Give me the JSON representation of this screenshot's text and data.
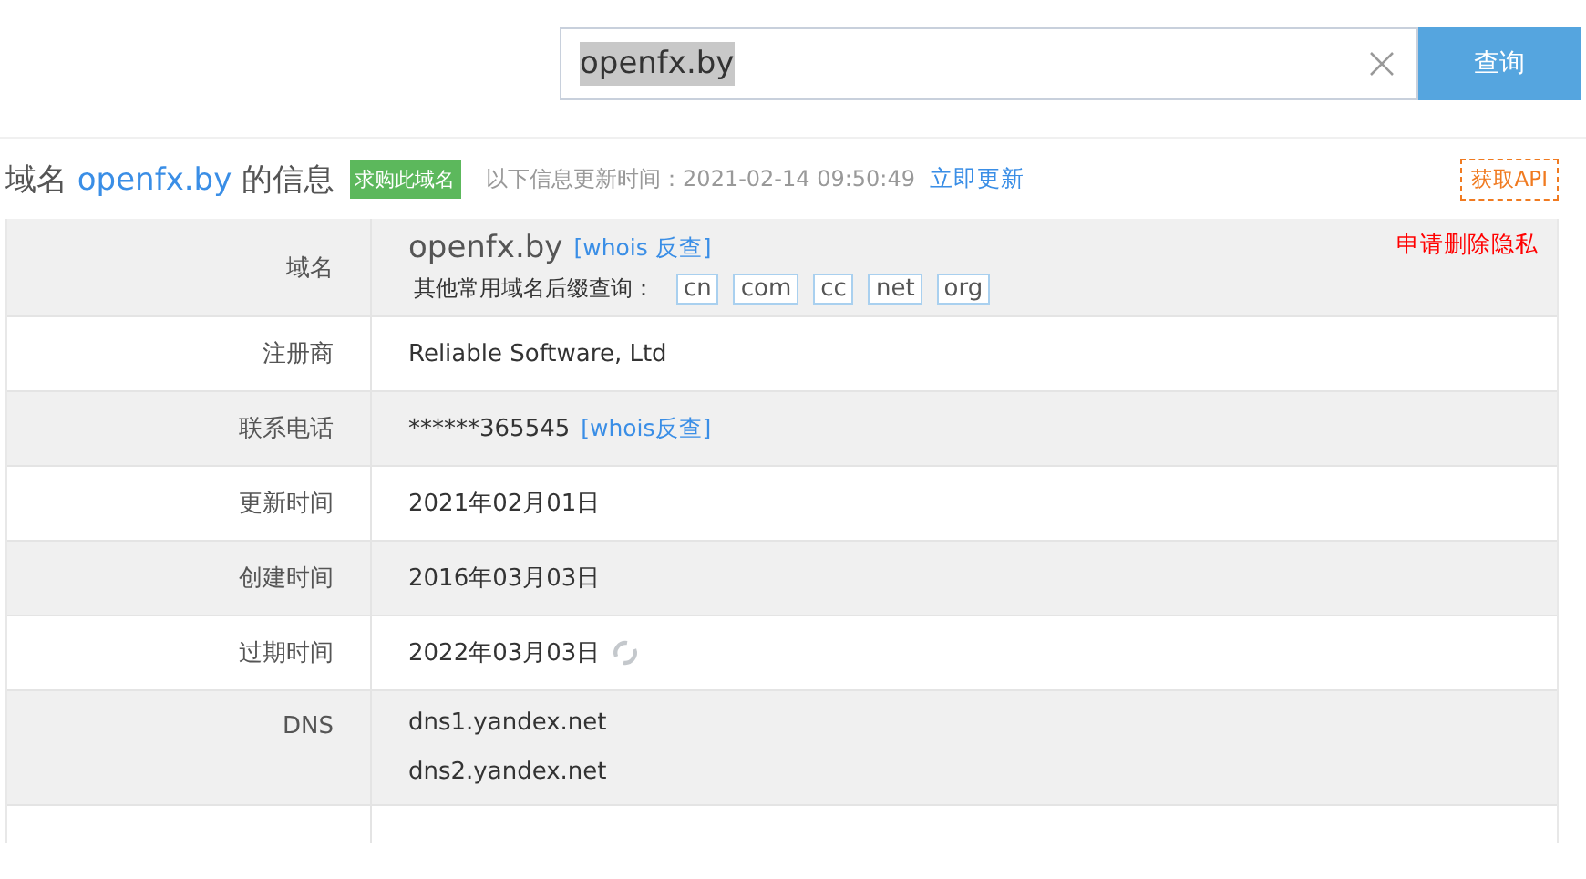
{
  "search": {
    "value": "openfx.by",
    "button": "查询"
  },
  "header": {
    "title_prefix": "域名",
    "domain": "openfx.by",
    "title_suffix": "的信息",
    "buy_badge": "求购此域名",
    "updated_label": "以下信息更新时间：2021-02-14 09:50:49",
    "update_link": "立即更新",
    "api_button": "获取API"
  },
  "rows": [
    {
      "kind": "domain",
      "label": "域名",
      "value": "openfx.by",
      "link": "[whois 反查]",
      "privacy_link": "申请删除隐私",
      "suffix_label": "其他常用域名后缀查询：",
      "suffixes": [
        "cn",
        "com",
        "cc",
        "net",
        "org"
      ]
    },
    {
      "kind": "text",
      "label": "注册商",
      "value": "Reliable Software, Ltd"
    },
    {
      "kind": "link",
      "label": "联系电话",
      "value": "******365545",
      "link": "[whois反查]"
    },
    {
      "kind": "text",
      "label": "更新时间",
      "value": "2021年02月01日"
    },
    {
      "kind": "text",
      "label": "创建时间",
      "value": "2016年03月03日"
    },
    {
      "kind": "refresh",
      "label": "过期时间",
      "value": "2022年03月03日"
    },
    {
      "kind": "list",
      "label": "DNS",
      "values": [
        "dns1.yandex.net",
        "dns2.yandex.net"
      ]
    }
  ]
}
